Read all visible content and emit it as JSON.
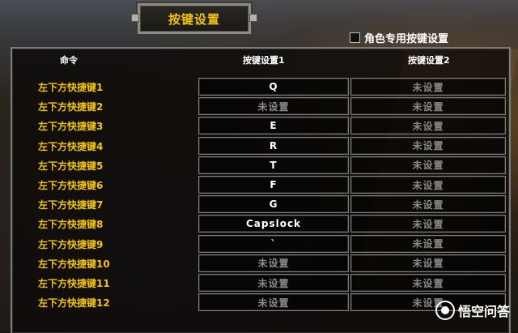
{
  "dialog": {
    "title": "按键设置",
    "character_specific_label": "角色专用按键设置"
  },
  "columns": {
    "command": "命令",
    "key1": "按键设置1",
    "key2": "按键设置2"
  },
  "rows": [
    {
      "command": "左下方快捷键1",
      "key1": "Q",
      "key2": "未设置"
    },
    {
      "command": "左下方快捷键2",
      "key1": "未设置",
      "key2": "未设置"
    },
    {
      "command": "左下方快捷键3",
      "key1": "E",
      "key2": "未设置"
    },
    {
      "command": "左下方快捷键4",
      "key1": "R",
      "key2": "未设置"
    },
    {
      "command": "左下方快捷键5",
      "key1": "T",
      "key2": "未设置"
    },
    {
      "command": "左下方快捷键6",
      "key1": "F",
      "key2": "未设置"
    },
    {
      "command": "左下方快捷键7",
      "key1": "G",
      "key2": "未设置"
    },
    {
      "command": "左下方快捷键8",
      "key1": "Capslock",
      "key2": "未设置"
    },
    {
      "command": "左下方快捷键9",
      "key1": "`",
      "key2": "未设置"
    },
    {
      "command": "左下方快捷键10",
      "key1": "未设置",
      "key2": "未设置"
    },
    {
      "command": "左下方快捷键11",
      "key1": "未设置",
      "key2": "未设置"
    },
    {
      "command": "左下方快捷键12",
      "key1": "未设置",
      "key2": "未设置"
    }
  ],
  "watermark": {
    "text": "悟空问答"
  },
  "colors": {
    "accent": "#f1c40f",
    "unset": "#8a8a8a"
  }
}
